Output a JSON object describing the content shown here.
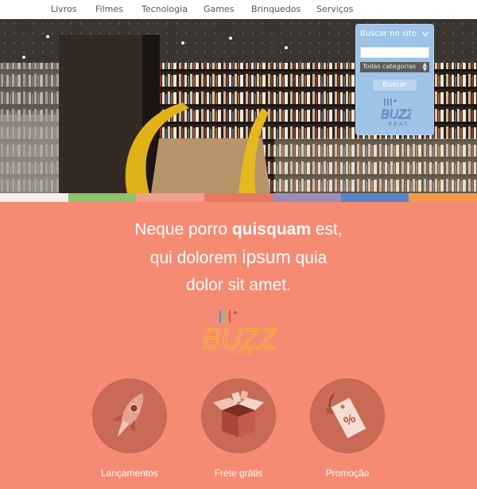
{
  "nav": {
    "items": [
      "Livros",
      "Filmes",
      "Tecnologia",
      "Games",
      "Brinquedos",
      "Serviços"
    ]
  },
  "search": {
    "title": "Buscar no site",
    "input_value": "",
    "category_selected": "Todas categorias",
    "button_label": "Buscar",
    "logo_text": "BUZZ",
    "logo_sub": "FEAT"
  },
  "colors": {
    "coral": "#f58b73",
    "search_blue": "#9dc3e6",
    "strip": [
      "#f3f0ec",
      "#8fc46d",
      "#f2a08b",
      "#e5795f",
      "#9c8cb9",
      "#5c84c4",
      "#f29b4c"
    ]
  },
  "hero": {
    "image_icon": "bookstore-photo"
  },
  "headline": {
    "line1_pre": "Neque porro ",
    "line1_bold": "quisquam",
    "line1_post": " est,",
    "line2_pre": "qui dolorem ",
    "line2_big": "ipsum",
    "line2_post": " quia",
    "line3": "dolor sit amet."
  },
  "brand": {
    "logo_text": "BUZZ",
    "logo_sub": "FEAT"
  },
  "features": [
    {
      "label": "Lançamentos",
      "icon": "rocket-icon"
    },
    {
      "label": "Frete grátis",
      "icon": "box-icon"
    },
    {
      "label": "Promoção",
      "icon": "discount-tag-icon"
    }
  ]
}
